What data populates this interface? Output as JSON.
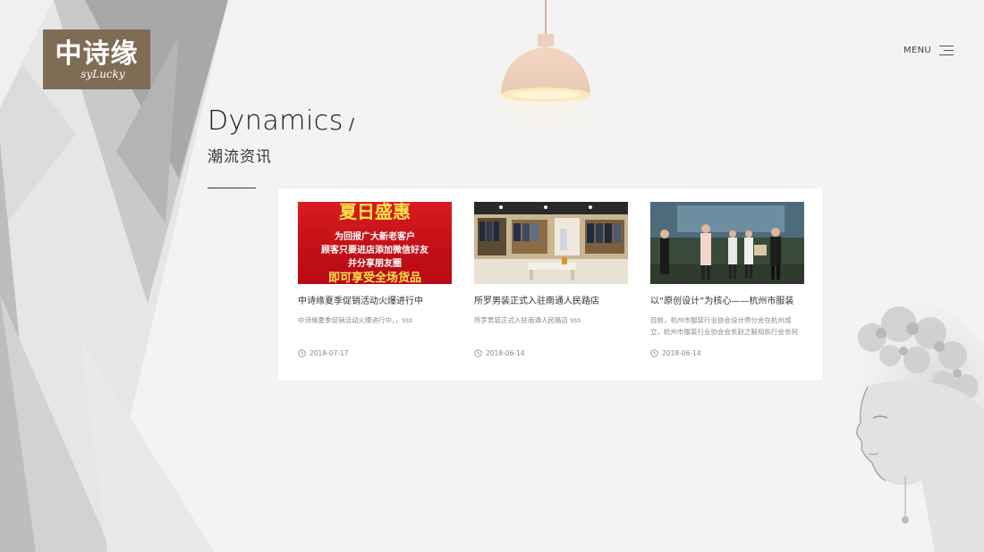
{
  "logo": {
    "cn": "中诗缘",
    "en": "syLucky"
  },
  "menu": {
    "label": "MENU",
    "icon": "hamburger-icon"
  },
  "heading": {
    "title_en": "Dynamics",
    "slash": "/",
    "title_cn": "潮流资讯"
  },
  "news": [
    {
      "title": "中诗缘夏季促销活动火爆进行中",
      "desc": "中诗缘夏季促销活动火爆进行中，，sss",
      "date": "2018-07-17",
      "image": {
        "top_text": "夏日盛惠",
        "lines": [
          "为回报广大新老客户",
          "顾客只要进店添加微信好友",
          "并分享朋友圈"
        ],
        "banner": "即可享受全场货品"
      }
    },
    {
      "title": "所罗男装正式入驻南通人民路店",
      "desc": "所罗男装正式入驻南通人民路店 sss",
      "date": "2018-06-14"
    },
    {
      "title": "以“原创设计”为核心——杭州市服装",
      "desc": "目前，杭州市服装行业协会设计师分会在杭州成立，杭州市服装行业协会会长赵之毅和执行会长何",
      "date": "2018-06-14"
    }
  ],
  "colors": {
    "logo_bg": "#7e6c55",
    "promo_red": "#c8131a",
    "promo_yellow": "#ffe14a"
  }
}
